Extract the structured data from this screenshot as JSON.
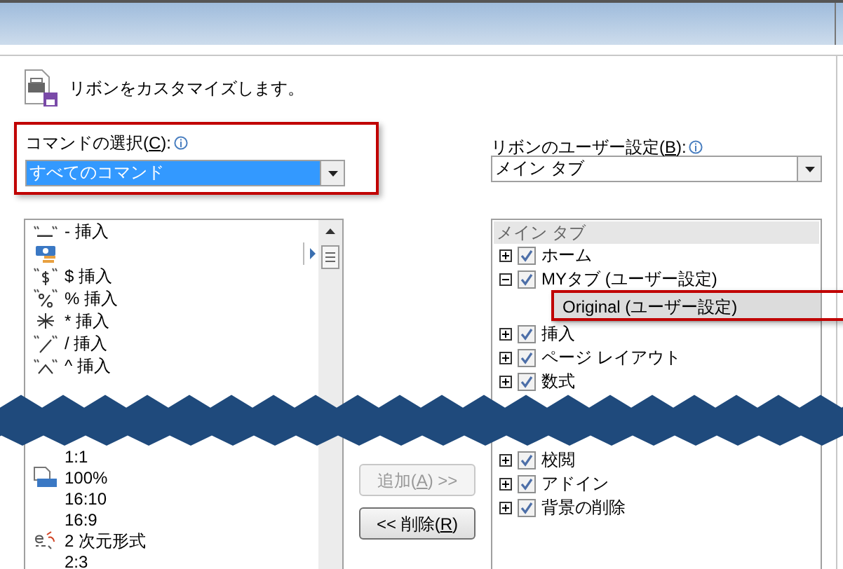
{
  "window": {
    "header": "リボンをカスタマイズします。"
  },
  "command_picker": {
    "label": {
      "prefix": "コマンドの選択(",
      "key": "C",
      "suffix": "):"
    },
    "value": "すべてのコマンド",
    "highlighted": true
  },
  "ribbon_picker": {
    "label": {
      "prefix": "リボンのユーザー設定(",
      "key": "B",
      "suffix": "):"
    },
    "value": "メイン タブ"
  },
  "command_list": {
    "before_tear": [
      {
        "label": "- 挿入",
        "submenu": false
      },
      {
        "submenu": true
      },
      {
        "label": "$ 挿入",
        "submenu": false
      },
      {
        "label": "% 挿入",
        "submenu": false
      },
      {
        "label": "* 挿入",
        "submenu": false
      },
      {
        "label": "/ 挿入",
        "submenu": false
      },
      {
        "label": "^ 挿入",
        "submenu": false
      }
    ],
    "after_tear": [
      {
        "label": "1:1",
        "submenu": false
      },
      {
        "label": "100%",
        "submenu": false
      },
      {
        "label": "16:10",
        "submenu": false
      },
      {
        "label": "16:9",
        "submenu": false
      },
      {
        "label": "2 次元形式",
        "submenu": false
      },
      {
        "label": "2:3",
        "submenu": false
      }
    ]
  },
  "buttons": [
    {
      "label": {
        "prefix": "追加(",
        "key": "A",
        "suffix": ") >>"
      },
      "disabled": true
    },
    {
      "label": {
        "prefix": "<< 削除(",
        "key": "R",
        "suffix": ")"
      },
      "disabled": false
    }
  ],
  "ribbon_tree": {
    "header": "メイン タブ",
    "before_tear": [
      {
        "label": "ホーム",
        "expanded": false,
        "checked": true,
        "selected": false
      },
      {
        "label": "MYタブ (ユーザー設定)",
        "expanded": true,
        "checked": true,
        "selected": false,
        "children": [
          {
            "label": "Original (ユーザー設定)",
            "selected": true,
            "highlighted": true
          }
        ]
      },
      {
        "label": "挿入",
        "expanded": false,
        "checked": true,
        "selected": false
      },
      {
        "label": "ページ レイアウト",
        "expanded": false,
        "checked": true,
        "selected": false
      },
      {
        "label": "数式",
        "expanded": false,
        "checked": true,
        "selected": false
      }
    ],
    "after_tear": [
      {
        "label": "校閲",
        "expanded": false,
        "checked": true,
        "selected": false
      },
      {
        "label": "アドイン",
        "expanded": false,
        "checked": true,
        "selected": false
      },
      {
        "label": "背景の削除",
        "expanded": false,
        "checked": true,
        "selected": false
      }
    ]
  }
}
